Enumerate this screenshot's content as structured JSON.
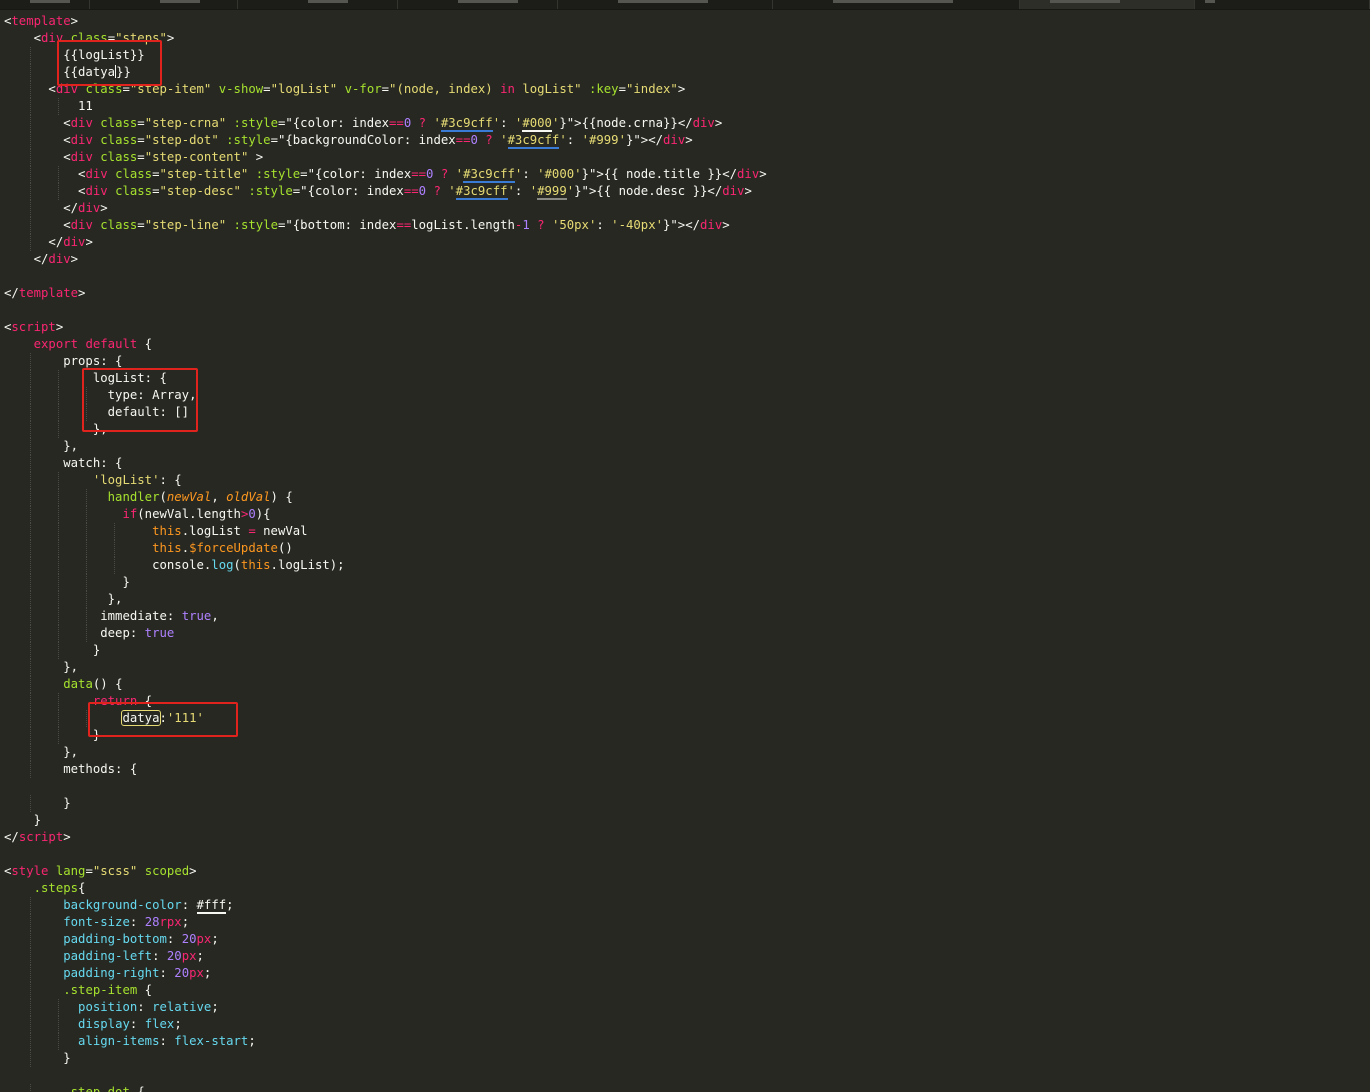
{
  "editor": {
    "theme": "dark",
    "tab_count": 7,
    "colors": {
      "background": "#272822",
      "annotation_box": "#e0241d",
      "tag": "#f92672",
      "attribute": "#a6e22e",
      "string": "#e6db74",
      "number": "#ae81ff"
    }
  },
  "code_lines": [
    [
      {
        "c": "p",
        "t": "<"
      },
      {
        "c": "kw",
        "t": "template"
      },
      {
        "c": "p",
        "t": ">"
      }
    ],
    [
      {
        "c": "p",
        "t": "    <"
      },
      {
        "c": "kw",
        "t": "div"
      },
      {
        "c": "p",
        "t": " "
      },
      {
        "c": "attr",
        "t": "class"
      },
      {
        "c": "p",
        "t": "="
      },
      {
        "c": "str",
        "t": "\"steps\""
      },
      {
        "c": "p",
        "t": ">"
      }
    ],
    [
      {
        "c": "p",
        "t": "        {{logList}}"
      }
    ],
    [
      {
        "c": "p",
        "t": "        {{datya"
      },
      {
        "c": "cursor",
        "t": ""
      },
      {
        "c": "p",
        "t": "}}"
      }
    ],
    [
      {
        "c": "p",
        "t": "      <"
      },
      {
        "c": "kw",
        "t": "div"
      },
      {
        "c": "p",
        "t": " "
      },
      {
        "c": "attr",
        "t": "class"
      },
      {
        "c": "p",
        "t": "="
      },
      {
        "c": "str",
        "t": "\"step-item\""
      },
      {
        "c": "p",
        "t": " "
      },
      {
        "c": "attr",
        "t": "v-show"
      },
      {
        "c": "p",
        "t": "="
      },
      {
        "c": "str",
        "t": "\"logList\""
      },
      {
        "c": "p",
        "t": " "
      },
      {
        "c": "attr",
        "t": "v-for"
      },
      {
        "c": "p",
        "t": "="
      },
      {
        "c": "str",
        "t": "\"(node, index) "
      },
      {
        "c": "kw",
        "t": "in"
      },
      {
        "c": "str",
        "t": " logList\""
      },
      {
        "c": "p",
        "t": " "
      },
      {
        "c": "attr",
        "t": ":key"
      },
      {
        "c": "p",
        "t": "="
      },
      {
        "c": "str",
        "t": "\"index\""
      },
      {
        "c": "p",
        "t": ">"
      }
    ],
    [
      {
        "c": "p",
        "t": "          11"
      }
    ],
    [
      {
        "c": "p",
        "t": "        <"
      },
      {
        "c": "kw",
        "t": "div"
      },
      {
        "c": "p",
        "t": " "
      },
      {
        "c": "attr",
        "t": "class"
      },
      {
        "c": "p",
        "t": "="
      },
      {
        "c": "str",
        "t": "\"step-crna\""
      },
      {
        "c": "p",
        "t": " "
      },
      {
        "c": "attr",
        "t": ":style"
      },
      {
        "c": "p",
        "t": "=\"{color: index"
      },
      {
        "c": "kw",
        "t": "=="
      },
      {
        "c": "num",
        "t": "0"
      },
      {
        "c": "p",
        "t": " "
      },
      {
        "c": "kw",
        "t": "?"
      },
      {
        "c": "p",
        "t": " "
      },
      {
        "c": "str",
        "t": "'"
      },
      {
        "c": "str-ul-blue",
        "t": "#3c9cff"
      },
      {
        "c": "str",
        "t": "'"
      },
      {
        "c": "p",
        "t": ": "
      },
      {
        "c": "str",
        "t": "'"
      },
      {
        "c": "str-ul-white",
        "t": "#000"
      },
      {
        "c": "str",
        "t": "'"
      },
      {
        "c": "p",
        "t": "}\">{{node.crna}}</"
      },
      {
        "c": "kw",
        "t": "div"
      },
      {
        "c": "p",
        "t": ">"
      }
    ],
    [
      {
        "c": "p",
        "t": "        <"
      },
      {
        "c": "kw",
        "t": "div"
      },
      {
        "c": "p",
        "t": " "
      },
      {
        "c": "attr",
        "t": "class"
      },
      {
        "c": "p",
        "t": "="
      },
      {
        "c": "str",
        "t": "\"step-dot\""
      },
      {
        "c": "p",
        "t": " "
      },
      {
        "c": "attr",
        "t": ":style"
      },
      {
        "c": "p",
        "t": "=\"{backgroundColor: index"
      },
      {
        "c": "kw",
        "t": "=="
      },
      {
        "c": "num",
        "t": "0"
      },
      {
        "c": "p",
        "t": " "
      },
      {
        "c": "kw",
        "t": "?"
      },
      {
        "c": "p",
        "t": " "
      },
      {
        "c": "str",
        "t": "'"
      },
      {
        "c": "str-ul-blue",
        "t": "#3c9cff"
      },
      {
        "c": "str",
        "t": "'"
      },
      {
        "c": "p",
        "t": ": "
      },
      {
        "c": "str",
        "t": "'#999'"
      },
      {
        "c": "p",
        "t": "}\"></"
      },
      {
        "c": "kw",
        "t": "div"
      },
      {
        "c": "p",
        "t": ">"
      }
    ],
    [
      {
        "c": "p",
        "t": "        <"
      },
      {
        "c": "kw",
        "t": "div"
      },
      {
        "c": "p",
        "t": " "
      },
      {
        "c": "attr",
        "t": "class"
      },
      {
        "c": "p",
        "t": "="
      },
      {
        "c": "str",
        "t": "\"step-content\""
      },
      {
        "c": "p",
        "t": " >"
      }
    ],
    [
      {
        "c": "p",
        "t": "          <"
      },
      {
        "c": "kw",
        "t": "div"
      },
      {
        "c": "p",
        "t": " "
      },
      {
        "c": "attr",
        "t": "class"
      },
      {
        "c": "p",
        "t": "="
      },
      {
        "c": "str",
        "t": "\"step-title\""
      },
      {
        "c": "p",
        "t": " "
      },
      {
        "c": "attr",
        "t": ":style"
      },
      {
        "c": "p",
        "t": "=\"{color: index"
      },
      {
        "c": "kw",
        "t": "=="
      },
      {
        "c": "num",
        "t": "0"
      },
      {
        "c": "p",
        "t": " "
      },
      {
        "c": "kw",
        "t": "?"
      },
      {
        "c": "p",
        "t": " "
      },
      {
        "c": "str",
        "t": "'"
      },
      {
        "c": "str-ul-blue",
        "t": "#3c9cff"
      },
      {
        "c": "str",
        "t": "'"
      },
      {
        "c": "p",
        "t": ": "
      },
      {
        "c": "str",
        "t": "'#000'"
      },
      {
        "c": "p",
        "t": "}\">{{ node.title }}</"
      },
      {
        "c": "kw",
        "t": "div"
      },
      {
        "c": "p",
        "t": ">"
      }
    ],
    [
      {
        "c": "p",
        "t": "          <"
      },
      {
        "c": "kw",
        "t": "div"
      },
      {
        "c": "p",
        "t": " "
      },
      {
        "c": "attr",
        "t": "class"
      },
      {
        "c": "p",
        "t": "="
      },
      {
        "c": "str",
        "t": "\"step-desc\""
      },
      {
        "c": "p",
        "t": " "
      },
      {
        "c": "attr",
        "t": ":style"
      },
      {
        "c": "p",
        "t": "=\"{color: index"
      },
      {
        "c": "kw",
        "t": "=="
      },
      {
        "c": "num",
        "t": "0"
      },
      {
        "c": "p",
        "t": " "
      },
      {
        "c": "kw",
        "t": "?"
      },
      {
        "c": "p",
        "t": " "
      },
      {
        "c": "str",
        "t": "'"
      },
      {
        "c": "str-ul-blue",
        "t": "#3c9cff"
      },
      {
        "c": "str",
        "t": "'"
      },
      {
        "c": "p",
        "t": ": "
      },
      {
        "c": "str",
        "t": "'"
      },
      {
        "c": "str-ul-grey",
        "t": "#999"
      },
      {
        "c": "str",
        "t": "'"
      },
      {
        "c": "p",
        "t": "}\">{{ node.desc }}</"
      },
      {
        "c": "kw",
        "t": "div"
      },
      {
        "c": "p",
        "t": ">"
      }
    ],
    [
      {
        "c": "p",
        "t": "        </"
      },
      {
        "c": "kw",
        "t": "div"
      },
      {
        "c": "p",
        "t": ">"
      }
    ],
    [
      {
        "c": "p",
        "t": "        <"
      },
      {
        "c": "kw",
        "t": "div"
      },
      {
        "c": "p",
        "t": " "
      },
      {
        "c": "attr",
        "t": "class"
      },
      {
        "c": "p",
        "t": "="
      },
      {
        "c": "str",
        "t": "\"step-line\""
      },
      {
        "c": "p",
        "t": " "
      },
      {
        "c": "attr",
        "t": ":style"
      },
      {
        "c": "p",
        "t": "=\"{bottom: index"
      },
      {
        "c": "kw",
        "t": "=="
      },
      {
        "c": "p",
        "t": "logList.length"
      },
      {
        "c": "kw",
        "t": "-"
      },
      {
        "c": "num",
        "t": "1"
      },
      {
        "c": "p",
        "t": " "
      },
      {
        "c": "kw",
        "t": "?"
      },
      {
        "c": "p",
        "t": " "
      },
      {
        "c": "str",
        "t": "'50px'"
      },
      {
        "c": "p",
        "t": ": "
      },
      {
        "c": "str",
        "t": "'-40px'"
      },
      {
        "c": "p",
        "t": "}\"></"
      },
      {
        "c": "kw",
        "t": "div"
      },
      {
        "c": "p",
        "t": ">"
      }
    ],
    [
      {
        "c": "p",
        "t": "      </"
      },
      {
        "c": "kw",
        "t": "div"
      },
      {
        "c": "p",
        "t": ">"
      }
    ],
    [
      {
        "c": "p",
        "t": "    </"
      },
      {
        "c": "kw",
        "t": "div"
      },
      {
        "c": "p",
        "t": ">"
      }
    ],
    [],
    [
      {
        "c": "p",
        "t": "</"
      },
      {
        "c": "kw",
        "t": "template"
      },
      {
        "c": "p",
        "t": ">"
      }
    ],
    [],
    [
      {
        "c": "p",
        "t": "<"
      },
      {
        "c": "kw",
        "t": "script"
      },
      {
        "c": "p",
        "t": ">"
      }
    ],
    [
      {
        "c": "p",
        "t": "    "
      },
      {
        "c": "kw",
        "t": "export"
      },
      {
        "c": "p",
        "t": " "
      },
      {
        "c": "kw",
        "t": "default"
      },
      {
        "c": "p",
        "t": " {"
      }
    ],
    [
      {
        "c": "p",
        "t": "        props: {"
      }
    ],
    [
      {
        "c": "p",
        "t": "            logList: {"
      }
    ],
    [
      {
        "c": "p",
        "t": "              type: Array,"
      }
    ],
    [
      {
        "c": "p",
        "t": "              default: []"
      }
    ],
    [
      {
        "c": "p",
        "t": "            },"
      }
    ],
    [
      {
        "c": "p",
        "t": "        },"
      }
    ],
    [
      {
        "c": "p",
        "t": "        watch: {"
      }
    ],
    [
      {
        "c": "p",
        "t": "            "
      },
      {
        "c": "str",
        "t": "'logList'"
      },
      {
        "c": "p",
        "t": ": {"
      }
    ],
    [
      {
        "c": "p",
        "t": "              "
      },
      {
        "c": "fn",
        "t": "handler"
      },
      {
        "c": "p",
        "t": "("
      },
      {
        "c": "italic",
        "t": "newVal"
      },
      {
        "c": "p",
        "t": ", "
      },
      {
        "c": "italic",
        "t": "oldVal"
      },
      {
        "c": "p",
        "t": ") {"
      }
    ],
    [
      {
        "c": "p",
        "t": "                "
      },
      {
        "c": "kw",
        "t": "if"
      },
      {
        "c": "p",
        "t": "(newVal.length"
      },
      {
        "c": "kw",
        "t": ">"
      },
      {
        "c": "num",
        "t": "0"
      },
      {
        "c": "p",
        "t": "){"
      }
    ],
    [
      {
        "c": "p",
        "t": "                    "
      },
      {
        "c": "this",
        "t": "this"
      },
      {
        "c": "p",
        "t": ".logList "
      },
      {
        "c": "kw",
        "t": "="
      },
      {
        "c": "p",
        "t": " newVal"
      }
    ],
    [
      {
        "c": "p",
        "t": "                    "
      },
      {
        "c": "this",
        "t": "this"
      },
      {
        "c": "p",
        "t": "."
      },
      {
        "c": "this",
        "t": "$forceUpdate"
      },
      {
        "c": "p",
        "t": "()"
      }
    ],
    [
      {
        "c": "p",
        "t": "                    console."
      },
      {
        "c": "def",
        "t": "log"
      },
      {
        "c": "p",
        "t": "("
      },
      {
        "c": "this",
        "t": "this"
      },
      {
        "c": "p",
        "t": ".logList);"
      }
    ],
    [
      {
        "c": "p",
        "t": "                }"
      }
    ],
    [
      {
        "c": "p",
        "t": "              },"
      }
    ],
    [
      {
        "c": "p",
        "t": "             immediate: "
      },
      {
        "c": "const",
        "t": "true"
      },
      {
        "c": "p",
        "t": ","
      }
    ],
    [
      {
        "c": "p",
        "t": "             deep: "
      },
      {
        "c": "const",
        "t": "true"
      }
    ],
    [
      {
        "c": "p",
        "t": "            }"
      }
    ],
    [
      {
        "c": "p",
        "t": "        },"
      }
    ],
    [
      {
        "c": "p",
        "t": "        "
      },
      {
        "c": "fn",
        "t": "data"
      },
      {
        "c": "p",
        "t": "() {"
      }
    ],
    [
      {
        "c": "p",
        "t": "            "
      },
      {
        "c": "kw",
        "t": "return"
      },
      {
        "c": "p",
        "t": " {"
      }
    ],
    [
      {
        "c": "p",
        "t": "                "
      },
      {
        "c": "boxed",
        "t": "datya"
      },
      {
        "c": "p",
        "t": ":"
      },
      {
        "c": "str",
        "t": "'111'"
      }
    ],
    [
      {
        "c": "p",
        "t": "            }"
      }
    ],
    [
      {
        "c": "p",
        "t": "        },"
      }
    ],
    [
      {
        "c": "p",
        "t": "        methods: {"
      }
    ],
    [],
    [
      {
        "c": "p",
        "t": "        }"
      }
    ],
    [
      {
        "c": "p",
        "t": "    }"
      }
    ],
    [
      {
        "c": "p",
        "t": "</"
      },
      {
        "c": "kw",
        "t": "script"
      },
      {
        "c": "p",
        "t": ">"
      }
    ],
    [],
    [
      {
        "c": "p",
        "t": "<"
      },
      {
        "c": "kw",
        "t": "style"
      },
      {
        "c": "p",
        "t": " "
      },
      {
        "c": "attr",
        "t": "lang"
      },
      {
        "c": "p",
        "t": "="
      },
      {
        "c": "str",
        "t": "\"scss\""
      },
      {
        "c": "p",
        "t": " "
      },
      {
        "c": "attr",
        "t": "scoped"
      },
      {
        "c": "p",
        "t": ">"
      }
    ],
    [
      {
        "c": "p",
        "t": "    "
      },
      {
        "c": "sel",
        "t": ".steps"
      },
      {
        "c": "p",
        "t": "{"
      }
    ],
    [
      {
        "c": "p",
        "t": "        "
      },
      {
        "c": "prop",
        "t": "background-color"
      },
      {
        "c": "p",
        "t": ": "
      },
      {
        "c": "ul-white",
        "t": "#fff"
      },
      {
        "c": "p",
        "t": ";"
      }
    ],
    [
      {
        "c": "p",
        "t": "        "
      },
      {
        "c": "prop",
        "t": "font-size"
      },
      {
        "c": "p",
        "t": ": "
      },
      {
        "c": "num",
        "t": "28"
      },
      {
        "c": "unit",
        "t": "rpx"
      },
      {
        "c": "p",
        "t": ";"
      }
    ],
    [
      {
        "c": "p",
        "t": "        "
      },
      {
        "c": "prop",
        "t": "padding-bottom"
      },
      {
        "c": "p",
        "t": ": "
      },
      {
        "c": "num",
        "t": "20"
      },
      {
        "c": "unit",
        "t": "px"
      },
      {
        "c": "p",
        "t": ";"
      }
    ],
    [
      {
        "c": "p",
        "t": "        "
      },
      {
        "c": "prop",
        "t": "padding-left"
      },
      {
        "c": "p",
        "t": ": "
      },
      {
        "c": "num",
        "t": "20"
      },
      {
        "c": "unit",
        "t": "px"
      },
      {
        "c": "p",
        "t": ";"
      }
    ],
    [
      {
        "c": "p",
        "t": "        "
      },
      {
        "c": "prop",
        "t": "padding-right"
      },
      {
        "c": "p",
        "t": ": "
      },
      {
        "c": "num",
        "t": "20"
      },
      {
        "c": "unit",
        "t": "px"
      },
      {
        "c": "p",
        "t": ";"
      }
    ],
    [
      {
        "c": "p",
        "t": "        "
      },
      {
        "c": "sel",
        "t": ".step-item"
      },
      {
        "c": "p",
        "t": " {"
      }
    ],
    [
      {
        "c": "p",
        "t": "          "
      },
      {
        "c": "prop",
        "t": "position"
      },
      {
        "c": "p",
        "t": ": "
      },
      {
        "c": "val",
        "t": "relative"
      },
      {
        "c": "p",
        "t": ";"
      }
    ],
    [
      {
        "c": "p",
        "t": "          "
      },
      {
        "c": "prop",
        "t": "display"
      },
      {
        "c": "p",
        "t": ": "
      },
      {
        "c": "val",
        "t": "flex"
      },
      {
        "c": "p",
        "t": ";"
      }
    ],
    [
      {
        "c": "p",
        "t": "          "
      },
      {
        "c": "prop",
        "t": "align-items"
      },
      {
        "c": "p",
        "t": ": "
      },
      {
        "c": "val",
        "t": "flex-start"
      },
      {
        "c": "p",
        "t": ";"
      }
    ],
    [
      {
        "c": "p",
        "t": "        }"
      }
    ],
    [],
    [
      {
        "c": "p",
        "t": "        "
      },
      {
        "c": "sel",
        "t": ".step-dot"
      },
      {
        "c": "p",
        "t": " {"
      }
    ]
  ]
}
